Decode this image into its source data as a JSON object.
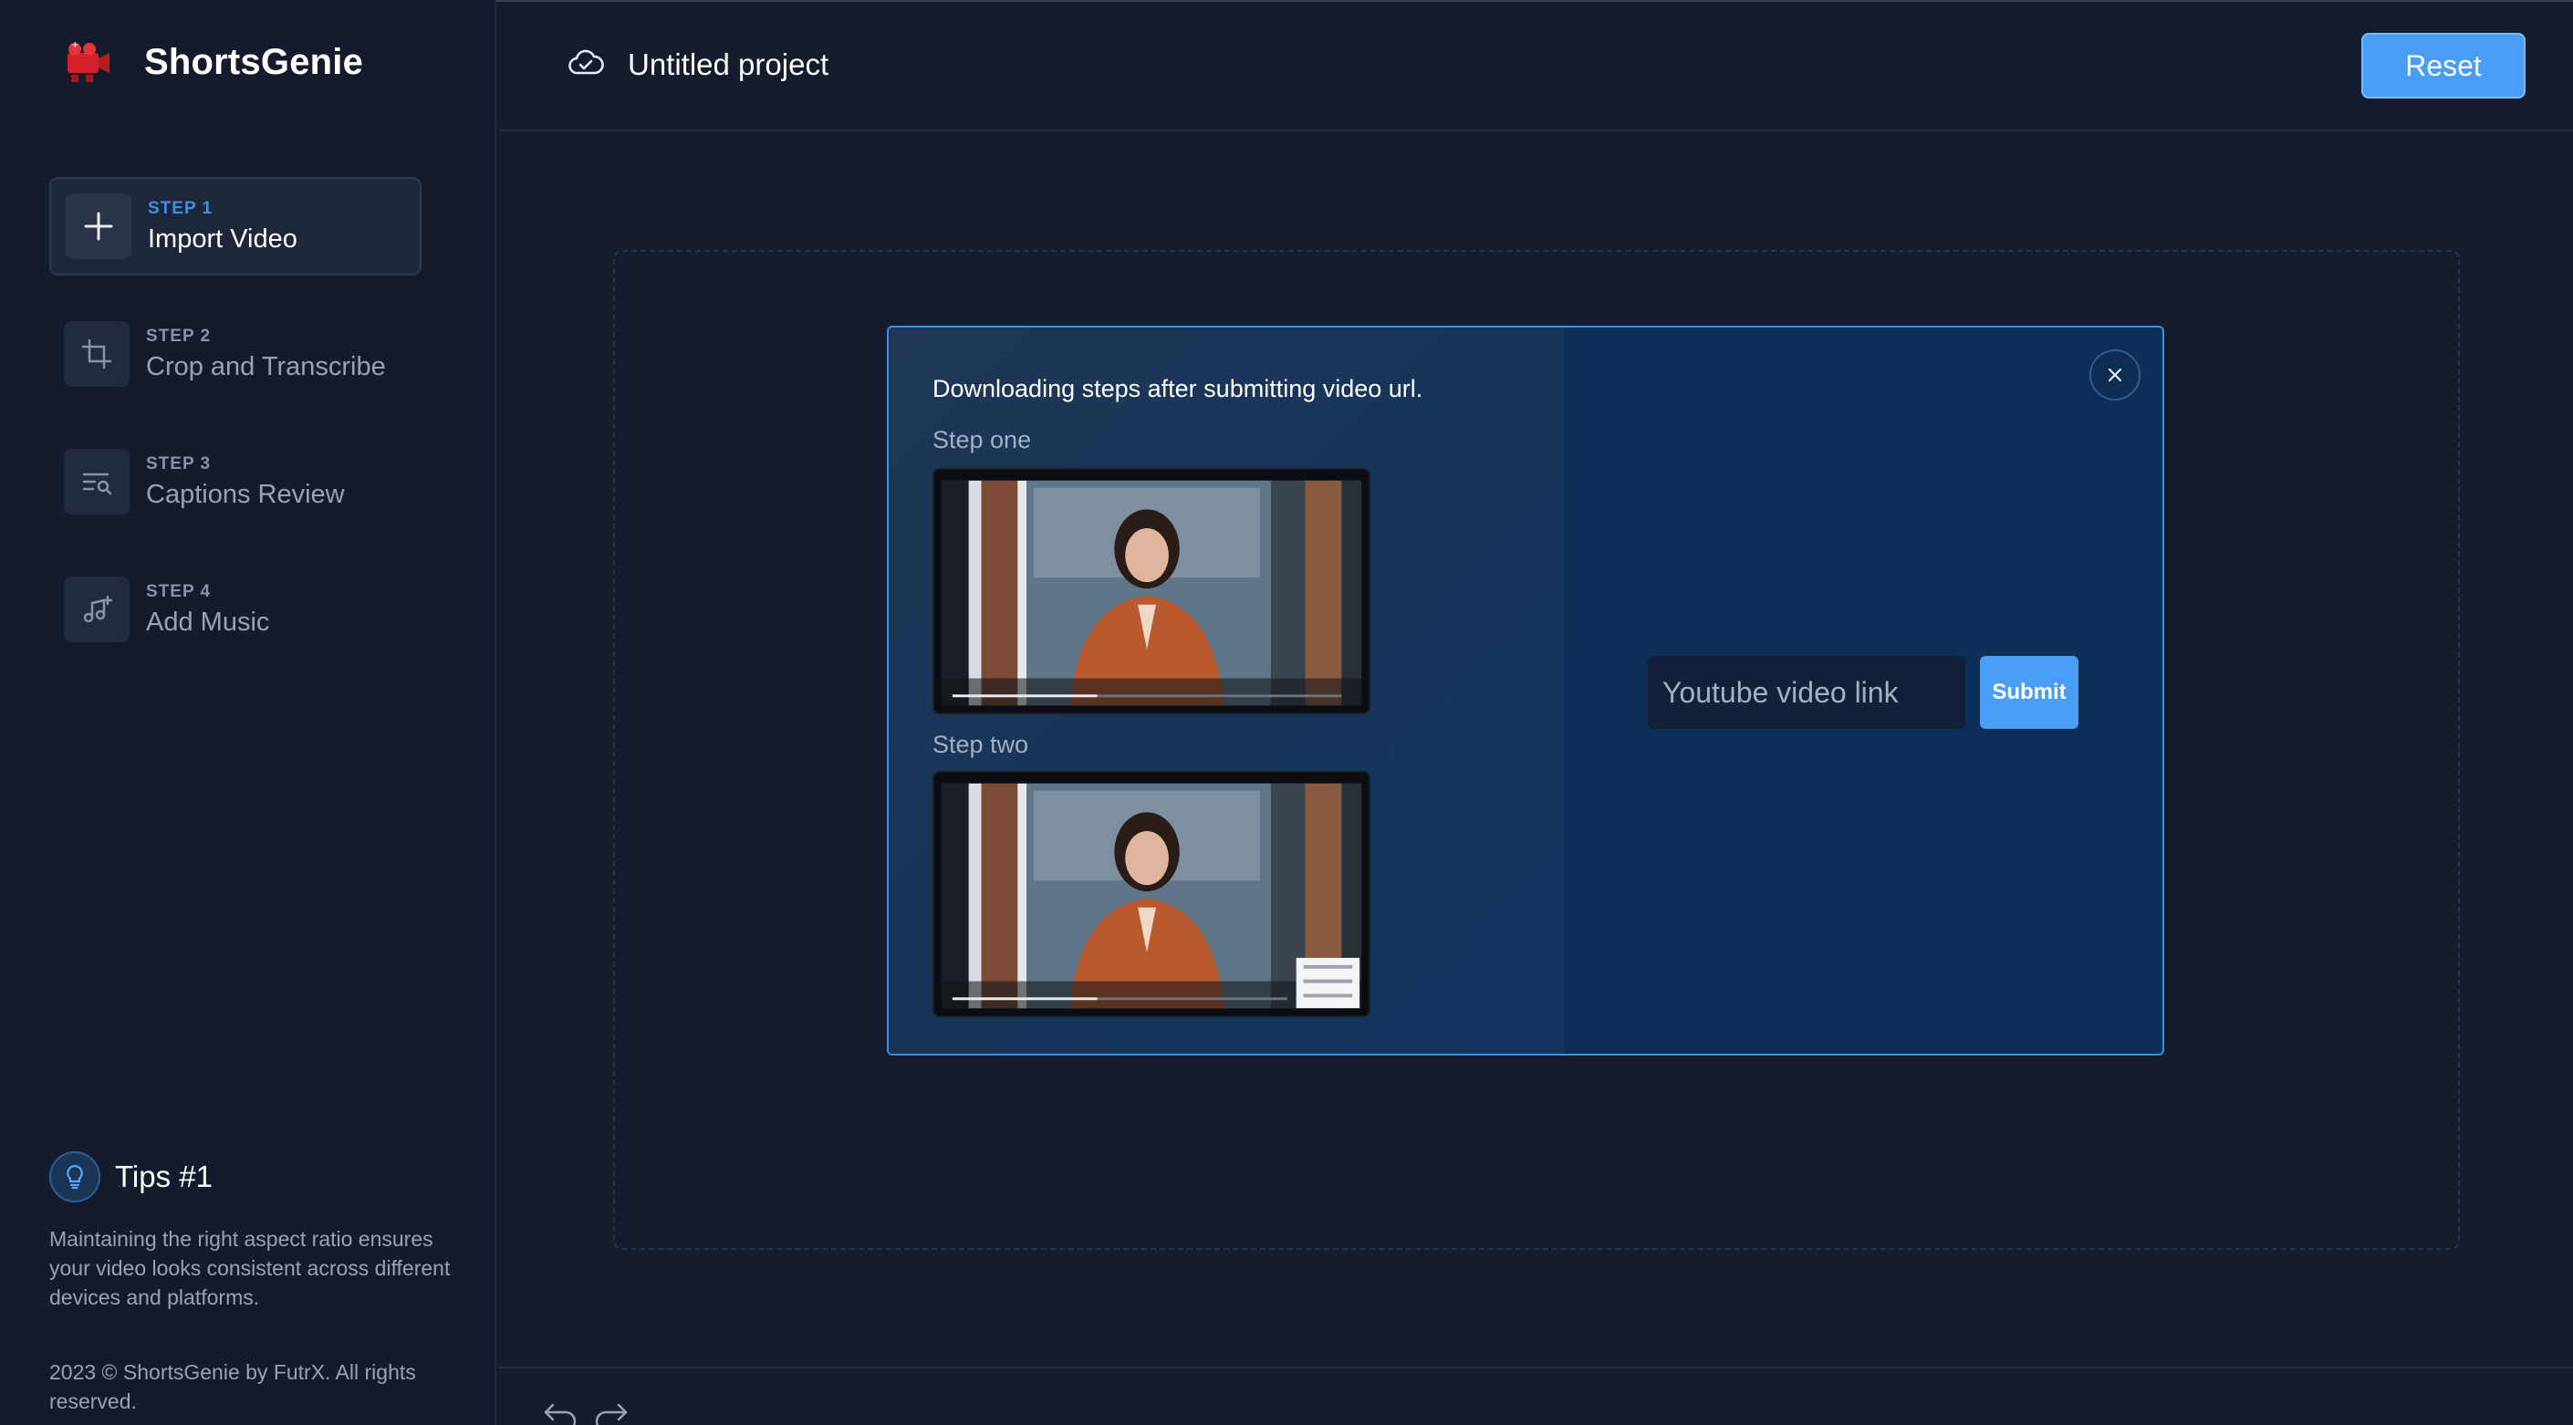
{
  "app": {
    "name": "ShortsGenie"
  },
  "sidebar": {
    "steps": [
      {
        "num": "STEP 1",
        "title": "Import Video",
        "icon": "plus-icon",
        "active": true
      },
      {
        "num": "STEP 2",
        "title": "Crop and Transcribe",
        "icon": "crop-icon",
        "active": false
      },
      {
        "num": "STEP 3",
        "title": "Captions Review",
        "icon": "captions-search-icon",
        "active": false
      },
      {
        "num": "STEP 4",
        "title": "Add Music",
        "icon": "music-add-icon",
        "active": false
      }
    ],
    "tips": {
      "title": "Tips #1",
      "body": "Maintaining the right aspect ratio ensures your video looks consistent across different devices and platforms."
    },
    "copyright": "2023 © ShortsGenie by FutrX. All rights reserved."
  },
  "header": {
    "project_title": "Untitled project",
    "reset_label": "Reset"
  },
  "modal": {
    "heading": "Downloading steps after submitting video url.",
    "step_one_label": "Step one",
    "step_two_label": "Step two",
    "input_placeholder": "Youtube video link",
    "submit_label": "Submit"
  },
  "colors": {
    "accent": "#4a9df4",
    "background": "#151c2e",
    "sidebar": "#141b2c",
    "modal_border": "#3a8fe6"
  }
}
